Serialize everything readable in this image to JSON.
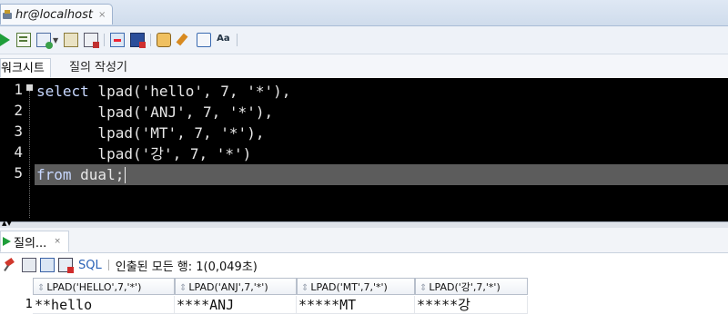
{
  "window": {
    "connection_tab": "hr@localhost",
    "connection_tab_close": "×"
  },
  "toolbar": {
    "icons": [
      "run-statement-icon",
      "run-script-icon",
      "commit-icon",
      "rollback-icon",
      "autotrace-icon",
      "explain-plan-icon",
      "sql-tuning-icon",
      "clear-icon",
      "history-icon",
      "format-case-icon"
    ]
  },
  "subtabs": {
    "worksheet": "워크시트",
    "query_builder": "질의 작성기"
  },
  "editor": {
    "line_numbers": [
      "1",
      "2",
      "3",
      "4",
      "5"
    ],
    "lines": [
      {
        "kw": "select",
        "rest": " lpad('hello', 7, '*'),"
      },
      {
        "kw": "",
        "rest": "       lpad('ANJ', 7, '*'),"
      },
      {
        "kw": "",
        "rest": "       lpad('MT', 7, '*'),"
      },
      {
        "kw": "",
        "rest": "       lpad('강', 7, '*')"
      },
      {
        "kw": "from",
        "rest": " dual;"
      }
    ]
  },
  "results": {
    "tab_label": "질의...",
    "tab_close": "×",
    "sql_label": "SQL",
    "status": "인출된 모든 행: 1(0,049초)",
    "columns": [
      "LPAD('HELLO',7,'*')",
      "LPAD('ANJ',7,'*')",
      "LPAD('MT',7,'*')",
      "LPAD('강',7,'*')"
    ],
    "rows": [
      {
        "num": "1",
        "cells": [
          "**hello",
          "****ANJ",
          "*****MT",
          "*****강"
        ]
      }
    ]
  },
  "colors": {
    "editor_bg": "#000000",
    "current_line": "#5c5c5c",
    "keyword": "#c8d8ff",
    "sql_link": "#2a62b7"
  }
}
